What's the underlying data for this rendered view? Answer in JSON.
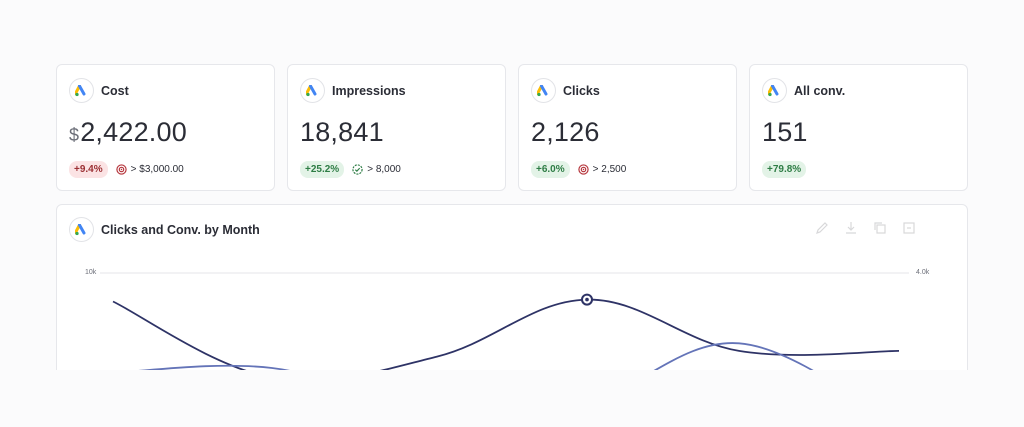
{
  "kpis": [
    {
      "title": "Cost",
      "currency": "$",
      "value": "2,422.00",
      "change": "+9.4%",
      "change_tone": "red",
      "target_icon": "target-icon",
      "target": "> $3,000.00",
      "target_color": "#b5343b"
    },
    {
      "title": "Impressions",
      "currency": "",
      "value": "18,841",
      "change": "+25.2%",
      "change_tone": "green",
      "target_icon": "target-met-icon",
      "target": "> 8,000",
      "target_color": "#2e7d45"
    },
    {
      "title": "Clicks",
      "currency": "",
      "value": "2,126",
      "change": "+6.0%",
      "change_tone": "green",
      "target_icon": "target-icon",
      "target": "> 2,500",
      "target_color": "#b5343b"
    },
    {
      "title": "All conv.",
      "currency": "",
      "value": "151",
      "change": "+79.8%",
      "change_tone": "green",
      "target_icon": "",
      "target": "",
      "target_color": ""
    }
  ],
  "chart": {
    "title": "Clicks and Conv. by Month",
    "toolbar_icons": [
      "edit-icon",
      "download-icon",
      "copy-icon",
      "more-icon"
    ]
  },
  "chart_data": {
    "type": "line",
    "title": "Clicks and Conv. by Month",
    "y_left_max_label": "10k",
    "y_right_max_label": "4.0k",
    "grid": true,
    "series": [
      {
        "axis": "left",
        "color": "#2e3366",
        "values": [
          8500,
          4500,
          5600,
          8600,
          5900,
          5900
        ]
      },
      {
        "axis": "right",
        "color": "#6474b8",
        "values": [
          1900,
          2000,
          1100,
          1300,
          2520,
          800
        ]
      }
    ]
  },
  "colors": {
    "dark_series": "#2e3366",
    "light_series": "#6474b8",
    "badge_red": "#9b2f33",
    "badge_green": "#2e7d45"
  }
}
